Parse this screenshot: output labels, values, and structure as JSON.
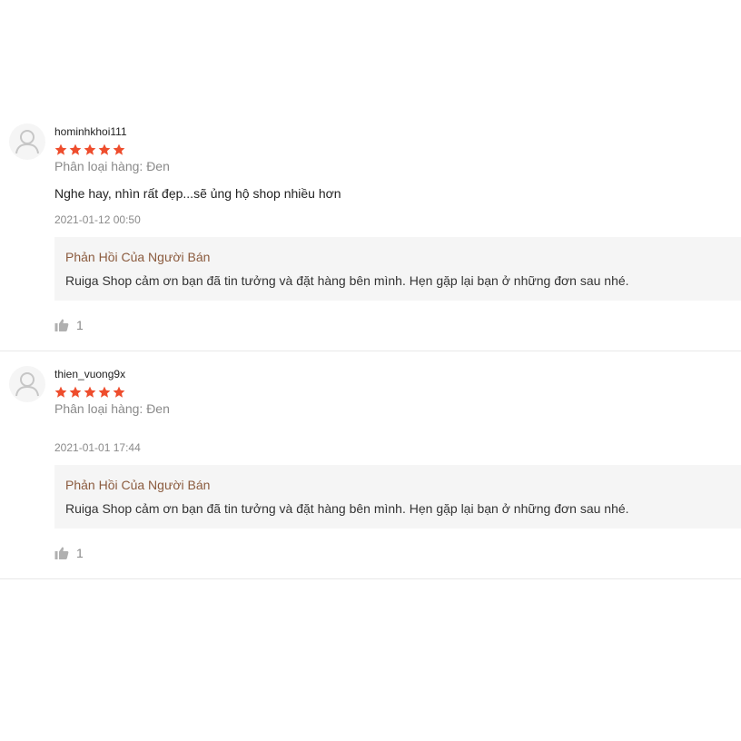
{
  "colors": {
    "star": "#ee4d2d",
    "reply_title": "#8b5b3e",
    "muted": "#8a8a8a"
  },
  "icons": {
    "avatar": "user-placeholder-icon",
    "star": "star-icon",
    "like": "thumbs-up-icon"
  },
  "reviews": [
    {
      "username": "hominhkhoi111",
      "rating": 5,
      "variation": "Phân loại hàng: Đen",
      "comment": "Nghe hay, nhìn rất đẹp...sẽ ủng hộ shop nhiều hơn",
      "time": "2021-01-12 00:50",
      "reply_title": "Phản Hồi Của Người Bán",
      "reply_text": "Ruiga Shop cảm ơn bạn đã tin tưởng và đặt hàng bên mình. Hẹn gặp lại bạn ở những đơn sau nhé.",
      "likes": "1"
    },
    {
      "username": "thien_vuong9x",
      "rating": 5,
      "variation": "Phân loại hàng: Đen",
      "comment": "",
      "time": "2021-01-01 17:44",
      "reply_title": "Phản Hồi Của Người Bán",
      "reply_text": "Ruiga Shop cảm ơn bạn đã tin tưởng và đặt hàng bên mình. Hẹn gặp lại bạn ở những đơn sau nhé.",
      "likes": "1"
    }
  ]
}
